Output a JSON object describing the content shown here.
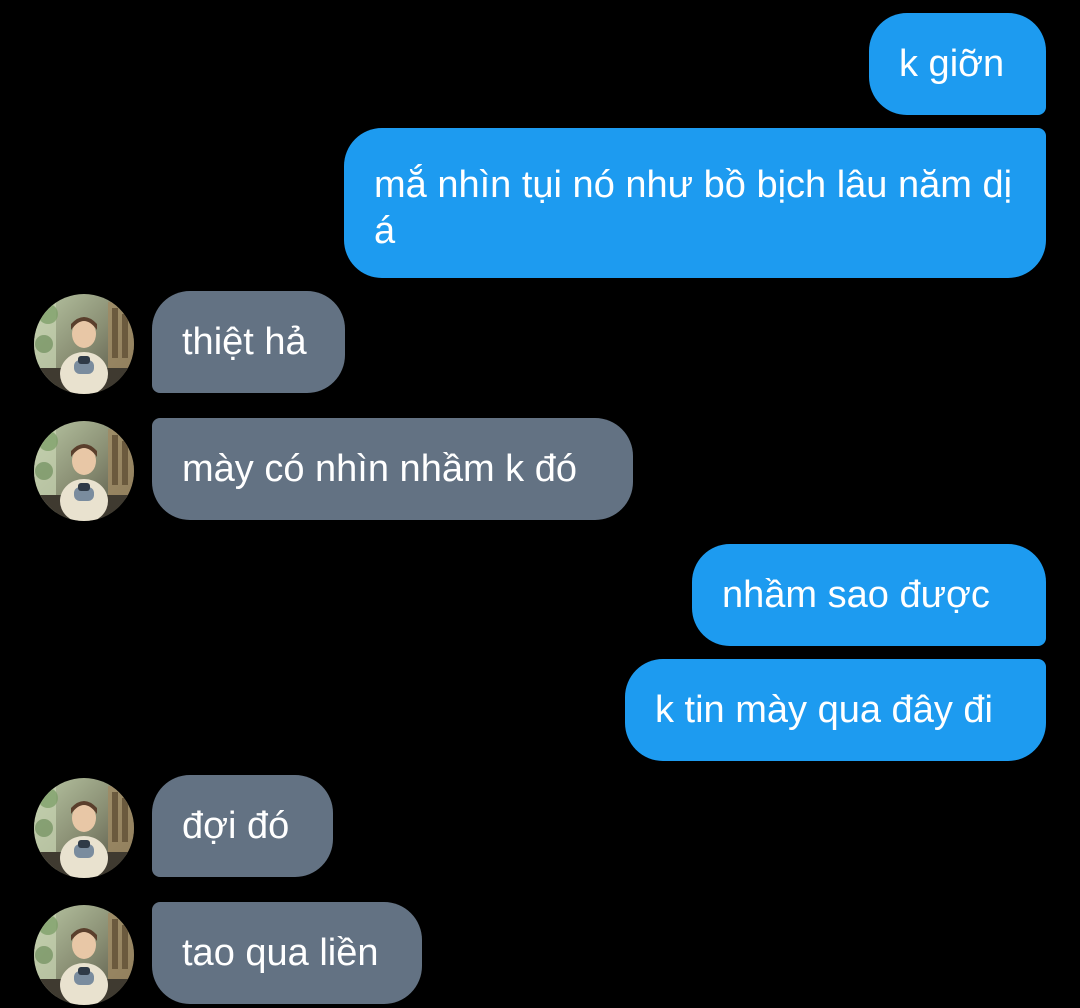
{
  "conversation": {
    "messages": [
      {
        "side": "sent",
        "text": "k giỡn"
      },
      {
        "side": "sent",
        "text": "mắ nhìn tụi nó như bồ bịch lâu năm dị á"
      },
      {
        "side": "received",
        "text": "thiệt hả"
      },
      {
        "side": "received",
        "text": "mày có nhìn nhầm k đó"
      },
      {
        "side": "sent",
        "text": "nhầm sao được"
      },
      {
        "side": "sent",
        "text": "k tin mày qua đây đi"
      },
      {
        "side": "received",
        "text": "đợi đó"
      },
      {
        "side": "received",
        "text": "tao qua liền"
      }
    ]
  },
  "colors": {
    "background": "#000000",
    "sent_bubble": "#1d9bf0",
    "received_bubble": "#637283",
    "text": "#ffffff"
  },
  "icons": {
    "contact_avatar": "avatar-photo"
  }
}
